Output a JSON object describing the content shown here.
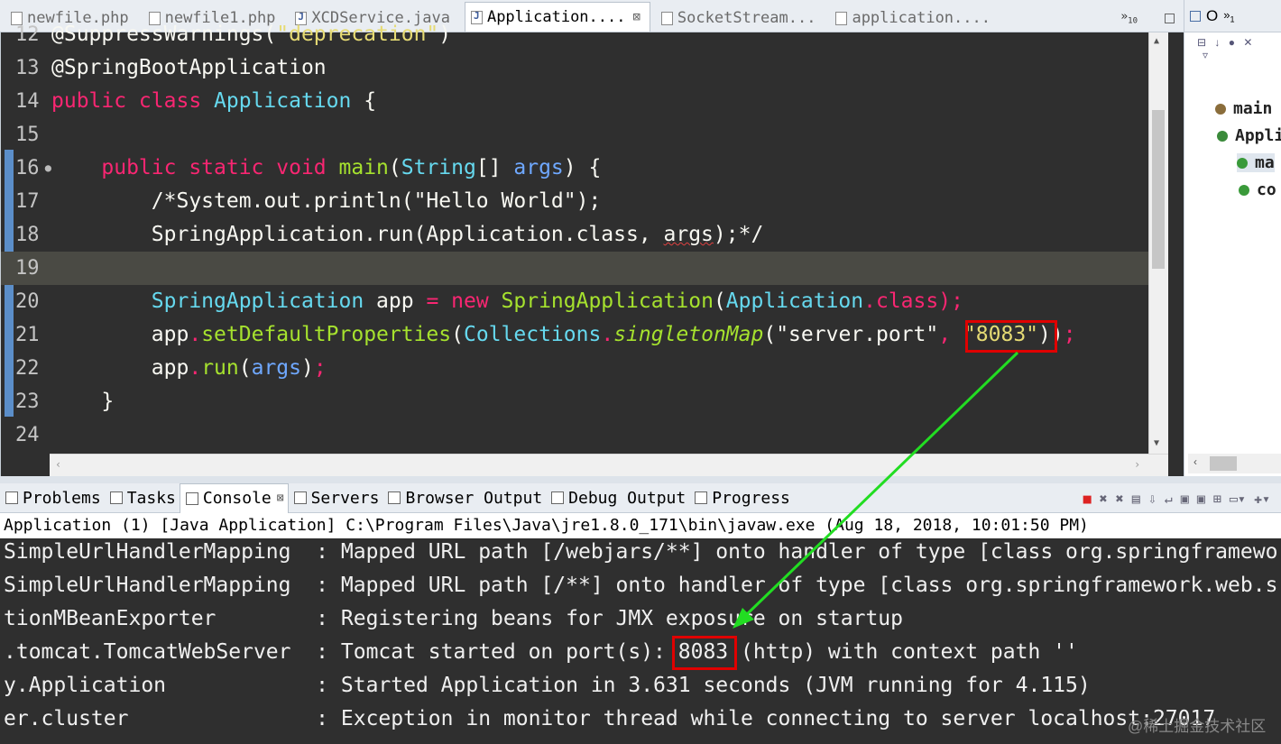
{
  "editor_tabs": [
    {
      "label": "newfile.php",
      "active": false
    },
    {
      "label": "newfile1.php",
      "active": false
    },
    {
      "label": "XCDService.java",
      "active": false
    },
    {
      "label": "Application....",
      "active": true,
      "close": "⊠"
    },
    {
      "label": "SocketStream...",
      "active": false
    },
    {
      "label": "application....",
      "active": false
    }
  ],
  "overflow_label": "»",
  "overflow_count": "10",
  "code_lines": [
    {
      "no": "12",
      "segments": [
        {
          "t": "@SuppressWarnings(",
          "c": "plain"
        },
        {
          "t": "\"deprecation\"",
          "c": "str"
        },
        {
          "t": ")",
          "c": "plain"
        }
      ]
    },
    {
      "no": "13",
      "segments": [
        {
          "t": "@SpringBootApplication",
          "c": "plain"
        }
      ]
    },
    {
      "no": "14",
      "segments": [
        {
          "t": "public class ",
          "c": "kw"
        },
        {
          "t": "Application",
          "c": "cls"
        },
        {
          "t": " {",
          "c": "plain"
        }
      ]
    },
    {
      "no": "15",
      "segments": []
    },
    {
      "no": "16",
      "marker": true,
      "segments": [
        {
          "t": "    ",
          "c": "plain"
        },
        {
          "t": "public static void ",
          "c": "kw"
        },
        {
          "t": "main",
          "c": "fn"
        },
        {
          "t": "(",
          "c": "plain"
        },
        {
          "t": "String",
          "c": "cls"
        },
        {
          "t": "[] ",
          "c": "plain"
        },
        {
          "t": "args",
          "c": "pm"
        },
        {
          "t": ") {",
          "c": "plain"
        }
      ]
    },
    {
      "no": "17",
      "segments": [
        {
          "t": "        /*System.out.println(\"Hello World\");",
          "c": "plain"
        }
      ]
    },
    {
      "no": "18",
      "segments": [
        {
          "t": "        SpringApplication.run(Application.class, ",
          "c": "plain"
        },
        {
          "t": "args",
          "c": "sq"
        },
        {
          "t": ");*/",
          "c": "plain"
        }
      ]
    },
    {
      "no": "19",
      "highlight": true,
      "segments": []
    },
    {
      "no": "20",
      "segments": [
        {
          "t": "        ",
          "c": "plain"
        },
        {
          "t": "SpringApplication",
          "c": "cls"
        },
        {
          "t": " app ",
          "c": "plain"
        },
        {
          "t": "= new ",
          "c": "kw"
        },
        {
          "t": "SpringApplication",
          "c": "fn"
        },
        {
          "t": "(",
          "c": "plain"
        },
        {
          "t": "Application",
          "c": "cls"
        },
        {
          "t": ".",
          "c": "kw"
        },
        {
          "t": "class",
          "c": "kw"
        },
        {
          "t": ");",
          "c": "kw"
        }
      ]
    },
    {
      "no": "21",
      "segments": [
        {
          "t": "        app",
          "c": "plain"
        },
        {
          "t": ".",
          "c": "kw"
        },
        {
          "t": "setDefaultProperties",
          "c": "fn"
        },
        {
          "t": "(",
          "c": "plain"
        },
        {
          "t": "Collections",
          "c": "cls"
        },
        {
          "t": ".",
          "c": "kw"
        },
        {
          "t": "singletonMap",
          "c": "it"
        },
        {
          "t": "(\"server.port\"",
          "c": "plain"
        },
        {
          "t": ", ",
          "c": "kw"
        },
        {
          "t": "\"8083\"",
          "c": "str"
        },
        {
          "t": "))",
          "c": "plain"
        },
        {
          "t": ";",
          "c": "kw"
        }
      ]
    },
    {
      "no": "22",
      "segments": [
        {
          "t": "        app",
          "c": "plain"
        },
        {
          "t": ".",
          "c": "kw"
        },
        {
          "t": "run",
          "c": "fn"
        },
        {
          "t": "(",
          "c": "plain"
        },
        {
          "t": "args",
          "c": "pm"
        },
        {
          "t": ")",
          "c": "plain"
        },
        {
          "t": ";",
          "c": "kw"
        }
      ]
    },
    {
      "no": "23",
      "segments": [
        {
          "t": "    }",
          "c": "plain"
        }
      ]
    },
    {
      "no": "24",
      "segments": []
    }
  ],
  "outline": {
    "tab_label": "O",
    "tab_extra": "»",
    "tab_extra_count": "1",
    "items": [
      {
        "label": "main",
        "color": "#8a6d3b",
        "selected": false
      },
      {
        "label": "Appli",
        "color": "#3a8a3a",
        "selected": false
      },
      {
        "label": "ma",
        "color": "#3a9a3a",
        "selected": true
      },
      {
        "label": "co",
        "color": "#3a9a3a",
        "selected": false
      }
    ]
  },
  "console_tabs": [
    {
      "label": "Problems",
      "active": false
    },
    {
      "label": "Tasks",
      "active": false
    },
    {
      "label": "Console",
      "active": true,
      "close": "⊠"
    },
    {
      "label": "Servers",
      "active": false
    },
    {
      "label": "Browser Output",
      "active": false
    },
    {
      "label": "Debug Output",
      "active": false
    },
    {
      "label": "Progress",
      "active": false
    }
  ],
  "console_header": "Application (1) [Java Application] C:\\Program Files\\Java\\jre1.8.0_171\\bin\\javaw.exe (Aug 18, 2018, 10:01:50 PM)",
  "console_lines": [
    "SimpleUrlHandlerMapping  : Mapped URL path [/webjars/**] onto handler of type [class org.springframewo",
    "SimpleUrlHandlerMapping  : Mapped URL path [/**] onto handler of type [class org.springframework.web.s",
    "tionMBeanExporter        : Registering beans for JMX exposure on startup",
    ".tomcat.TomcatWebServer  : Tomcat started on port(s): 8083 (http) with context path ''",
    "y.Application            : Started Application in 3.631 seconds (JVM running for 4.115)",
    "er.cluster               : Exception in monitor thread while connecting to server localhost:27017"
  ],
  "watermark": "@稀土掘金技术社区",
  "colors": {
    "annotation_box": "#e00000",
    "arrow": "#22dd22"
  }
}
